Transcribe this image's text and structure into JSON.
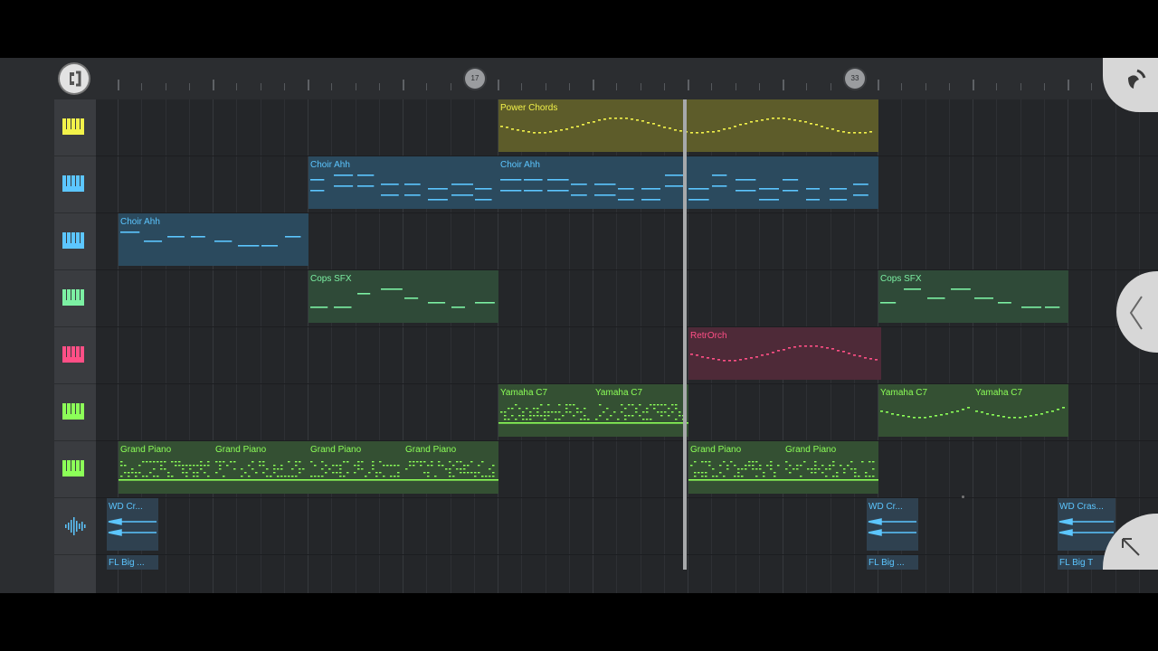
{
  "ruler": {
    "markers": [
      "17",
      "33"
    ]
  },
  "clips": [
    {
      "label": "Power Chords",
      "color": "#f2f24a",
      "bg": "#5d5c2a"
    },
    {
      "label": "Choir Ahh",
      "color": "#5cc6ff",
      "bg": "#2b4a5e"
    },
    {
      "label": "Choir Ahh",
      "color": "#5cc6ff",
      "bg": "#2b4a5e"
    },
    {
      "label": "Choir Ahh",
      "color": "#5cc6ff",
      "bg": "#2b4a5e"
    },
    {
      "label": "Cops SFX",
      "color": "#7cf0a3",
      "bg": "#2f4a38"
    },
    {
      "label": "Cops SFX",
      "color": "#7cf0a3",
      "bg": "#2f4a38"
    },
    {
      "label": "RetrOrch",
      "color": "#ff4f86",
      "bg": "#4e2a38"
    },
    {
      "label": "Yamaha C7",
      "color": "#8cff58",
      "bg": "#345033"
    },
    {
      "label": "Yamaha C7",
      "color": "#8cff58",
      "bg": "#345033"
    },
    {
      "label": "Yamaha C7",
      "color": "#8cff58",
      "bg": "#345033"
    },
    {
      "label": "Yamaha C7",
      "color": "#8cff58",
      "bg": "#345033"
    },
    {
      "label": "Grand Piano",
      "color": "#8cff58",
      "bg": "#345033"
    },
    {
      "label": "Grand Piano",
      "color": "#8cff58",
      "bg": "#345033"
    },
    {
      "label": "Grand Piano",
      "color": "#8cff58",
      "bg": "#345033"
    },
    {
      "label": "Grand Piano",
      "color": "#8cff58",
      "bg": "#345033"
    },
    {
      "label": "Grand Piano",
      "color": "#8cff58",
      "bg": "#345033"
    },
    {
      "label": "Grand Piano",
      "color": "#8cff58",
      "bg": "#345033"
    },
    {
      "label": "WD Cr...",
      "color": "#5cc6ff",
      "bg": "#2f4150"
    },
    {
      "label": "WD Cr...",
      "color": "#5cc6ff",
      "bg": "#2f4150"
    },
    {
      "label": "WD Cras...",
      "color": "#5cc6ff",
      "bg": "#2f4150"
    },
    {
      "label": "FL Big ...",
      "color": "#5cc6ff",
      "bg": "#2f4150"
    },
    {
      "label": "FL Big ...",
      "color": "#5cc6ff",
      "bg": "#2f4150"
    },
    {
      "label": "FL Big T",
      "color": "#5cc6ff",
      "bg": "#2f4150"
    }
  ],
  "track_icons": [
    {
      "icon": "piano-icon",
      "color": "#f2f24a"
    },
    {
      "icon": "piano-icon",
      "color": "#5cc6ff"
    },
    {
      "icon": "piano-icon",
      "color": "#5cc6ff"
    },
    {
      "icon": "piano-icon",
      "color": "#7cf0a3"
    },
    {
      "icon": "piano-icon",
      "color": "#ff4f86"
    },
    {
      "icon": "piano-icon",
      "color": "#8cff58"
    },
    {
      "icon": "piano-icon",
      "color": "#8cff58"
    },
    {
      "icon": "waveform-icon",
      "color": "#5cc6ff"
    }
  ]
}
